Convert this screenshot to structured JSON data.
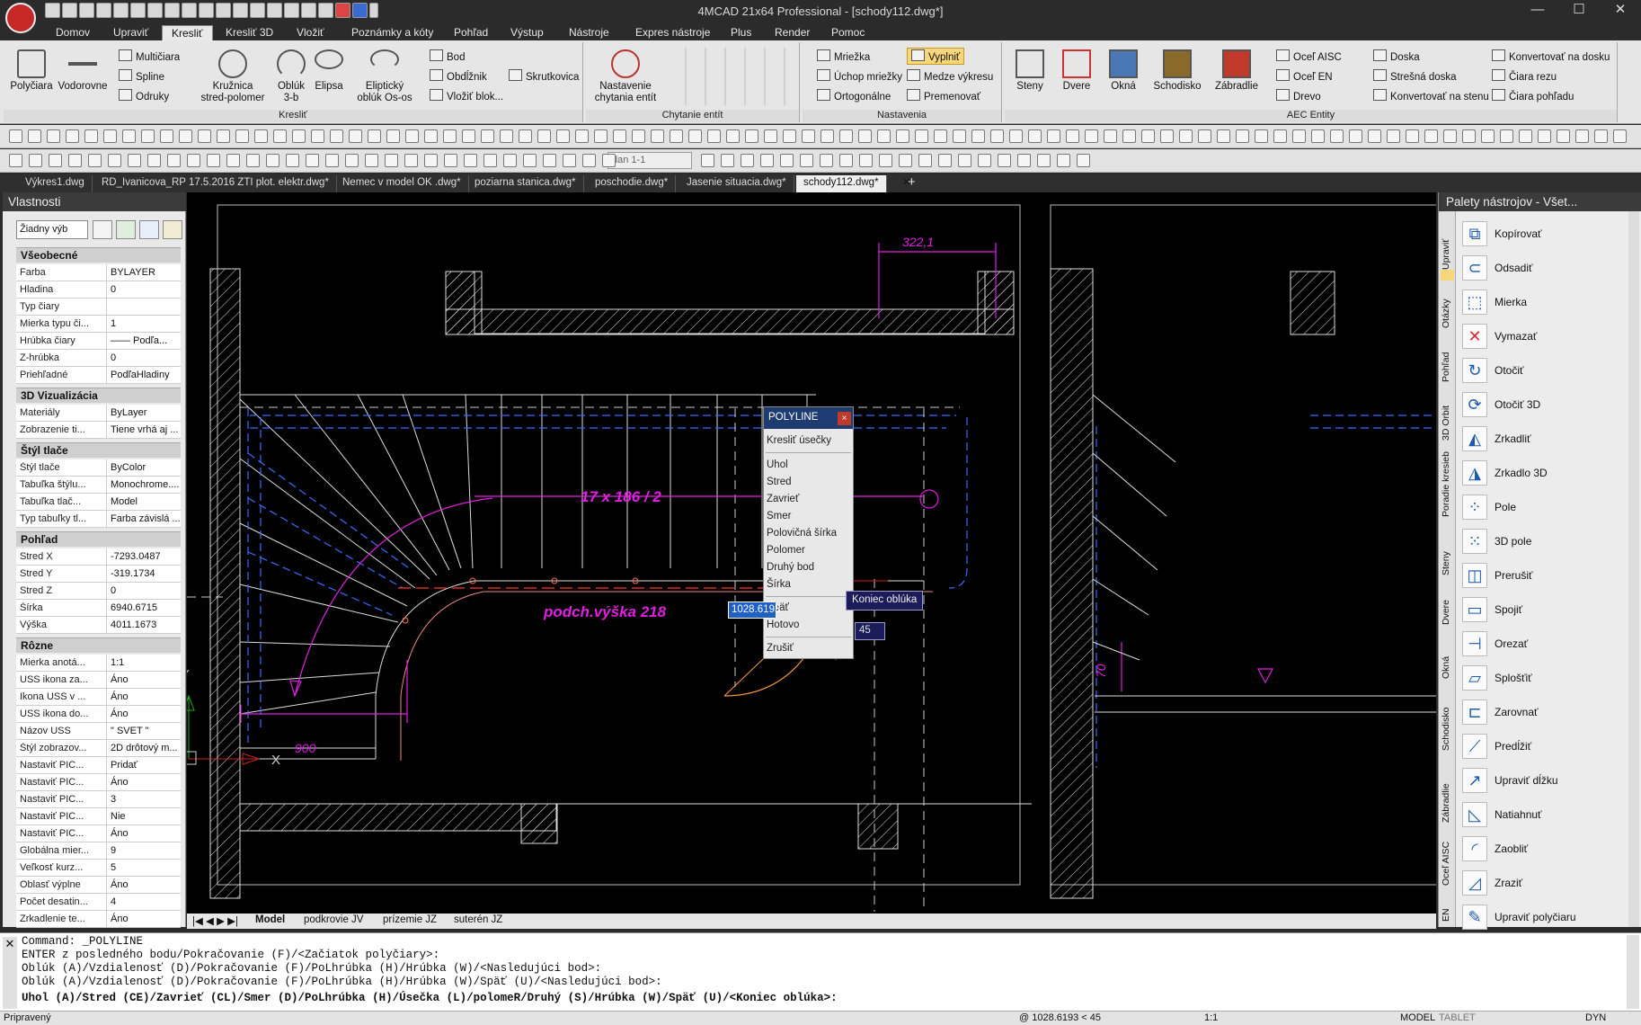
{
  "app": {
    "title": "4MCAD 21x64 Professional - [schody112.dwg*]",
    "window_buttons": [
      "—",
      "☐",
      "✕"
    ]
  },
  "menu_tabs": [
    "Domov",
    "Upraviť",
    "Kresliť",
    "Kresliť 3D",
    "Vložiť",
    "Poznámky a kóty",
    "Pohľad",
    "Výstup",
    "Nástroje",
    "Expres nástroje",
    "Plus",
    "Render",
    "Pomoc"
  ],
  "active_menu_tab": "Kresliť",
  "ribbon": {
    "kreslit": {
      "title": "Kresliť",
      "polyline": "Polyčiara",
      "vodorovne": "Vodorovne",
      "multiciara": "Multičiara",
      "spline": "Spline",
      "odruky": "Odruky",
      "kruznica": "Kružnica\nstred-polomer",
      "obluk": "Oblúk\n3-b",
      "elipsa": "Elipsa",
      "elipticky": "Eliptický\noblúk Os-os",
      "bod": "Bod",
      "obdlznik": "Obdĺžnik",
      "vlozit_blok": "Vložiť blok...",
      "skrutkovica": "Skrutkovica"
    },
    "chytanie": {
      "title": "Chytanie entít",
      "nastavenie": "Nastavenie\nchytania entít"
    },
    "nastavenia": {
      "title": "Nastavenia",
      "mriezka": "Mriežka",
      "uchop": "Úchop mriežky",
      "ortogonalne": "Ortogonálne",
      "vyplnit": "Vyplniť",
      "medze": "Medze výkresu",
      "premenovat": "Premenovať"
    },
    "aec": {
      "title": "AEC Entity",
      "steny": "Steny",
      "dvere": "Dvere",
      "okna": "Okná",
      "schodisko": "Schodisko",
      "zabradlie": "Zábradlie",
      "ocel_aisc": "Oceľ AISC",
      "ocel_en": "Oceľ EN",
      "drevo": "Drevo",
      "doska": "Doska",
      "stresna": "Strešná doska",
      "konv_stena": "Konvertovať na stenu",
      "konv_doska": "Konvertovať na dosku",
      "ciara_rezu": "Čiara rezu",
      "ciara_pohladu": "Čiara pohľadu"
    }
  },
  "toolbar": {
    "view_combo": "dan 1-1"
  },
  "doc_tabs": [
    "Výkres1.dwg",
    "RD_Ivanicova_RP 17.5.2016 ZTI plot. elektr.dwg*",
    "Nemec v model OK .dwg*",
    "poziarna stanica.dwg*",
    "poschodie.dwg*",
    "Jasenie situacia.dwg*",
    "schody112.dwg*"
  ],
  "active_doc_tab": "schody112.dwg*",
  "properties": {
    "title": "Vlastnosti",
    "selection": "Žiadny výb",
    "sections": [
      {
        "name": "Všeobecné",
        "rows": [
          [
            "Farba",
            "BYLAYER"
          ],
          [
            "Hladina",
            "0"
          ],
          [
            "Typ čiary",
            ""
          ],
          [
            "Mierka typu či...",
            "1"
          ],
          [
            "Hrúbka čiary",
            "—— Podľa..."
          ],
          [
            "Z-hrúbka",
            "0"
          ],
          [
            "Priehľadné",
            "PodľaHladiny"
          ]
        ]
      },
      {
        "name": "3D Vizualizácia",
        "rows": [
          [
            "Materiály",
            "ByLayer"
          ],
          [
            "Zobrazenie ti...",
            "Tiene vrhá aj ..."
          ]
        ]
      },
      {
        "name": "Štýl tlače",
        "rows": [
          [
            "Štýl tlače",
            "ByColor"
          ],
          [
            "Tabuľka štýlu...",
            "Monochrome...."
          ],
          [
            "Tabuľka tlač...",
            "Model"
          ],
          [
            "Typ tabuľky tl...",
            "Farba závislá ..."
          ]
        ]
      },
      {
        "name": "Pohľad",
        "rows": [
          [
            "Stred X",
            "-7293.0487"
          ],
          [
            "Stred Y",
            "-319.1734"
          ],
          [
            "Stred Z",
            "0"
          ],
          [
            "Šírka",
            "6940.6715"
          ],
          [
            "Výška",
            "4011.1673"
          ]
        ]
      },
      {
        "name": "Rôzne",
        "rows": [
          [
            "Mierka anotá...",
            "1:1"
          ],
          [
            "USS ikona za...",
            "Áno"
          ],
          [
            "Ikona USS v ...",
            "Áno"
          ],
          [
            "USS ikona do...",
            "Áno"
          ],
          [
            "Názov USS",
            "\" SVET \""
          ],
          [
            "Štýl zobrazov...",
            "2D drôtový m..."
          ],
          [
            "Nastaviť PIC...",
            "Pridať"
          ],
          [
            "Nastaviť PIC...",
            "Áno"
          ],
          [
            "Nastaviť PIC...",
            "3"
          ],
          [
            "Nastaviť PIC...",
            "Nie"
          ],
          [
            "Nastaviť PIC...",
            "Áno"
          ],
          [
            "Globálna mier...",
            "9"
          ],
          [
            "Veľkosť kurz...",
            "5"
          ],
          [
            "Oblasť výplne",
            "Áno"
          ],
          [
            "Počet desatin...",
            "4"
          ],
          [
            "Zrkadlenie te...",
            "Áno"
          ]
        ]
      }
    ]
  },
  "drawing": {
    "dim_top": "322,1",
    "stair_label": "17 x 186 / 2",
    "height_label": "podch.výška 218",
    "dim_bottom": "900",
    "dim_right": "70",
    "axis_x": "X",
    "axis_y": "Y",
    "input_value": "1028.6193",
    "angle_value": "45",
    "tooltip": "Koniec oblúka"
  },
  "popup": {
    "title": "POLYLINE",
    "close": "×",
    "items": [
      "Kresliť úsečky",
      "Uhol",
      "Stred",
      "Zavrieť",
      "Smer",
      "Polovičná šírka",
      "Polomer",
      "Druhý bod",
      "Šírka",
      "Späť",
      "Hotovo",
      "Zrušiť"
    ]
  },
  "layout_tabs": [
    "Model",
    "podkrovie JV",
    "prízemie JZ",
    "suterén JZ"
  ],
  "palette": {
    "title": "Palety nástrojov - Všet...",
    "vertical_tabs": [
      "Upraviť",
      "Otázky",
      "Pohľad",
      "3D Orbit",
      "Poradie kresieb",
      "Steny",
      "Dvere",
      "Okná",
      "Schodisko",
      "Zábradlie",
      "Oceľ AISC",
      "EN"
    ],
    "items": [
      {
        "label": "Kopírovať",
        "icon": "copy-icon",
        "glyph": "⧉"
      },
      {
        "label": "Odsadiť",
        "icon": "offset-icon",
        "glyph": "⊂"
      },
      {
        "label": "Mierka",
        "icon": "scale-icon",
        "glyph": "⬚"
      },
      {
        "label": "Vymazať",
        "icon": "erase-icon",
        "glyph": "✕"
      },
      {
        "label": "Otočiť",
        "icon": "rotate-icon",
        "glyph": "↻"
      },
      {
        "label": "Otočiť 3D",
        "icon": "rotate3d-icon",
        "glyph": "⟳"
      },
      {
        "label": "Zrkadliť",
        "icon": "mirror-icon",
        "glyph": "◭"
      },
      {
        "label": "Zrkadlo 3D",
        "icon": "mirror3d-icon",
        "glyph": "◮"
      },
      {
        "label": "Pole",
        "icon": "array-icon",
        "glyph": "⁘"
      },
      {
        "label": "3D pole",
        "icon": "array3d-icon",
        "glyph": "⁙"
      },
      {
        "label": "Prerušiť",
        "icon": "break-icon",
        "glyph": "◫"
      },
      {
        "label": "Spojiť",
        "icon": "join-icon",
        "glyph": "▭"
      },
      {
        "label": "Orezať",
        "icon": "trim-icon",
        "glyph": "⊣"
      },
      {
        "label": "Splošťiť",
        "icon": "flatten-icon",
        "glyph": "▱"
      },
      {
        "label": "Zarovnať",
        "icon": "align-icon",
        "glyph": "⊏"
      },
      {
        "label": "Predĺžiť",
        "icon": "extend-icon",
        "glyph": "⟋"
      },
      {
        "label": "Upraviť dĺžku",
        "icon": "lengthen-icon",
        "glyph": "↗"
      },
      {
        "label": "Natiahnuť",
        "icon": "stretch-icon",
        "glyph": "◺"
      },
      {
        "label": "Zaobliť",
        "icon": "fillet-icon",
        "glyph": "◜"
      },
      {
        "label": "Zraziť",
        "icon": "chamfer-icon",
        "glyph": "◿"
      },
      {
        "label": "Upraviť polyčiaru",
        "icon": "pedit-icon",
        "glyph": "✎"
      }
    ]
  },
  "command": {
    "lines": [
      "Command: _POLYLINE",
      "ENTER z posledného bodu/Pokračovanie (F)/<Začiatok polyčiary>:",
      "Oblúk (A)/Vzdialenosť (D)/Pokračovanie (F)/PoLhrúbka (H)/Hrúbka (W)/<Nasledujúci bod>:",
      "Oblúk (A)/Vzdialenosť (D)/Pokračovanie (F)/PoLhrúbka (H)/Hrúbka (W)/Späť (U)/<Nasledujúci bod>:"
    ],
    "prompt": "Uhol (A)/Stred (CE)/Zavrieť (CL)/Smer (D)/PoLhrúbka (H)/Úsečka (L)/polomeR/Druhý (S)/Hrúbka (W)/Späť (U)/<Koniec oblúka>:"
  },
  "status": {
    "left": "Pripravený",
    "coords": "@ 1028.6193 < 45",
    "scale": "1:1",
    "model": "MODEL",
    "tablet": "TABLET",
    "dyn": "DYN"
  },
  "colors": {
    "accent": "#1e3c72",
    "drawing_bg": "#000000",
    "magenta": "#e020e0",
    "cyan_dash": "#3a6cff"
  }
}
